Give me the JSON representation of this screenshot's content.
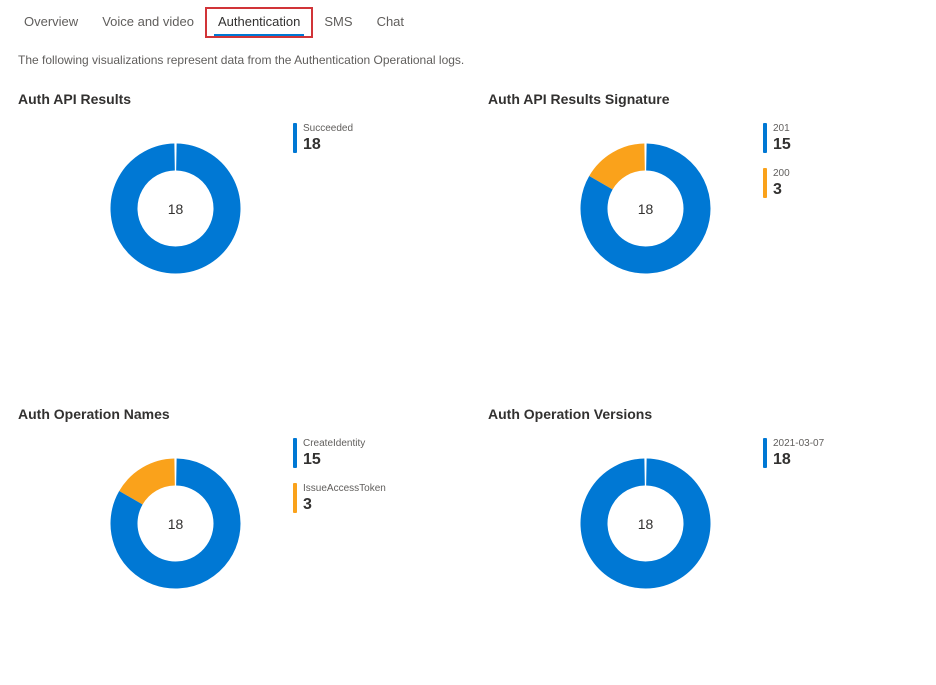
{
  "tabs": [
    {
      "label": "Overview",
      "active": false
    },
    {
      "label": "Voice and video",
      "active": false
    },
    {
      "label": "Authentication",
      "active": true,
      "highlighted": true
    },
    {
      "label": "SMS",
      "active": false
    },
    {
      "label": "Chat",
      "active": false
    }
  ],
  "description": "The following visualizations represent data from the Authentication Operational logs.",
  "colors": {
    "blue": "#0078d4",
    "orange": "#faa21b"
  },
  "charts": [
    {
      "title": "Auth API Results",
      "total": "18",
      "slices": [
        {
          "label": "Succeeded",
          "value": "18",
          "color": "#0078d4",
          "fraction": 1.0
        }
      ]
    },
    {
      "title": "Auth API Results Signature",
      "total": "18",
      "slices": [
        {
          "label": "201",
          "value": "15",
          "color": "#0078d4",
          "fraction": 0.8333
        },
        {
          "label": "200",
          "value": "3",
          "color": "#faa21b",
          "fraction": 0.1667
        }
      ]
    },
    {
      "title": "Auth Operation Names",
      "total": "18",
      "slices": [
        {
          "label": "CreateIdentity",
          "value": "15",
          "color": "#0078d4",
          "fraction": 0.8333
        },
        {
          "label": "IssueAccessToken",
          "value": "3",
          "color": "#faa21b",
          "fraction": 0.1667
        }
      ]
    },
    {
      "title": "Auth Operation Versions",
      "total": "18",
      "slices": [
        {
          "label": "2021-03-07",
          "value": "18",
          "color": "#0078d4",
          "fraction": 1.0
        }
      ]
    }
  ],
  "chart_data": [
    {
      "type": "pie",
      "title": "Auth API Results",
      "categories": [
        "Succeeded"
      ],
      "values": [
        18
      ]
    },
    {
      "type": "pie",
      "title": "Auth API Results Signature",
      "categories": [
        "201",
        "200"
      ],
      "values": [
        15,
        3
      ]
    },
    {
      "type": "pie",
      "title": "Auth Operation Names",
      "categories": [
        "CreateIdentity",
        "IssueAccessToken"
      ],
      "values": [
        15,
        3
      ]
    },
    {
      "type": "pie",
      "title": "Auth Operation Versions",
      "categories": [
        "2021-03-07"
      ],
      "values": [
        18
      ]
    }
  ]
}
